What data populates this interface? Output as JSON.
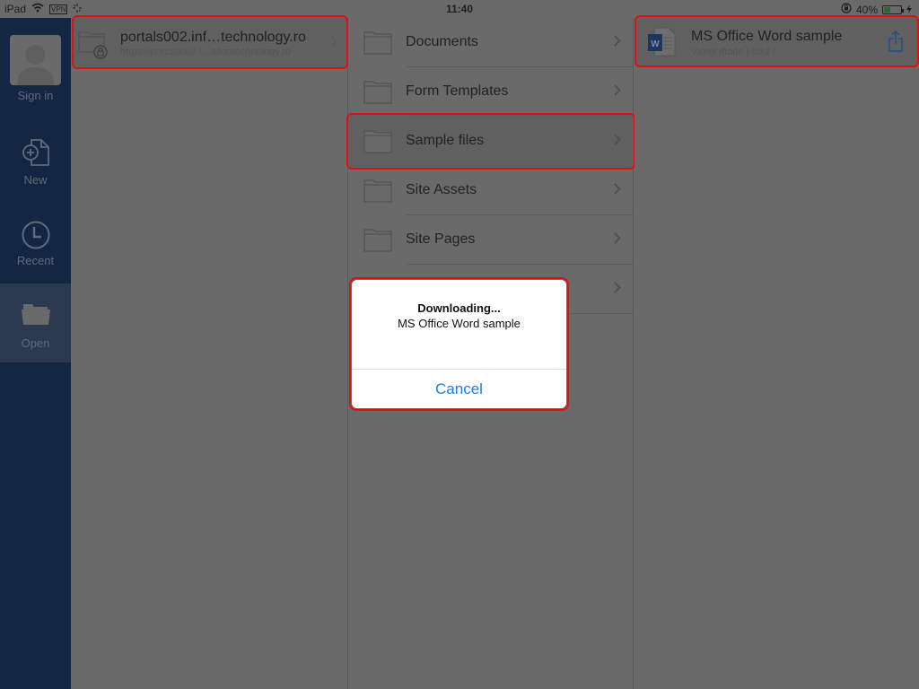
{
  "status_bar": {
    "device": "iPad",
    "vpn_label": "VPN",
    "time": "11:40",
    "battery_percent": "40%",
    "battery_level": 0.4
  },
  "sidebar": {
    "items": [
      {
        "label": "Sign in",
        "icon": "avatar-icon"
      },
      {
        "label": "New",
        "icon": "new-document-icon"
      },
      {
        "label": "Recent",
        "icon": "clock-icon"
      },
      {
        "label": "Open",
        "icon": "folder-open-icon",
        "active": true
      }
    ]
  },
  "locations": {
    "site": {
      "title": "portals002.inf…technology.ro",
      "url": "https://portals002.i…ationtechnology.ro",
      "icon": "locked-folder-icon"
    }
  },
  "folders": {
    "items": [
      {
        "name": "Documents"
      },
      {
        "name": "Form Templates"
      },
      {
        "name": "Sample files",
        "selected": true
      },
      {
        "name": "Site Assets"
      },
      {
        "name": "Site Pages"
      },
      {
        "name": ""
      }
    ]
  },
  "files": {
    "items": [
      {
        "title": "MS Office Word sample",
        "subtitle": "Viorel Iftode | 08:27",
        "icon": "word-document-icon",
        "action_icon": "share-icon"
      }
    ]
  },
  "dialog": {
    "title": "Downloading...",
    "message": "MS Office Word sample",
    "cancel_label": "Cancel"
  },
  "colors": {
    "highlight": "#e01010",
    "sidebar_bg": "#132642",
    "accent": "#1a7fe0"
  }
}
